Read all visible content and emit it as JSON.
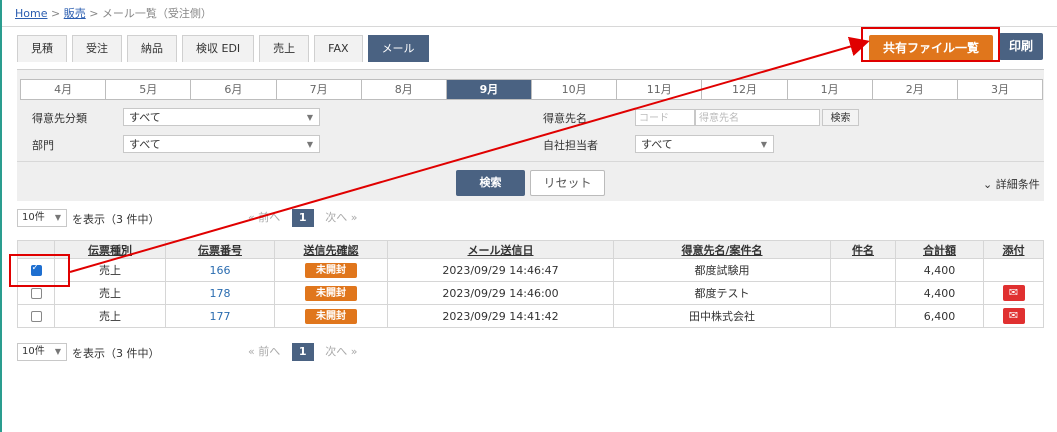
{
  "breadcrumb": {
    "home": "Home",
    "sales": "販売",
    "sep": ">",
    "current": "メール一覧（受注側）"
  },
  "tabs": [
    {
      "label": "見積"
    },
    {
      "label": "受注"
    },
    {
      "label": "納品"
    },
    {
      "label": "検収 EDI"
    },
    {
      "label": "売上"
    },
    {
      "label": "FAX"
    },
    {
      "label": "メール"
    }
  ],
  "active_tab": "メール",
  "actions": {
    "share_files": "共有ファイル一覧",
    "print": "印刷"
  },
  "months": [
    "4月",
    "5月",
    "6月",
    "7月",
    "8月",
    "9月",
    "10月",
    "11月",
    "12月",
    "1月",
    "2月",
    "3月"
  ],
  "active_month": "9月",
  "filters": {
    "customer_class_label": "得意先分類",
    "customer_class_value": "すべて",
    "dept_label": "部門",
    "dept_value": "すべて",
    "customer_name_label": "得意先名",
    "code_placeholder": "コード",
    "name_placeholder": "得意先名",
    "search_small": "検索",
    "staff_label": "自社担当者",
    "staff_value": "すべて"
  },
  "buttons": {
    "search": "検索",
    "reset": "リセット",
    "detail": "詳細条件"
  },
  "pagination": {
    "per_page": "10件",
    "display_text": "を表示（3 件中）",
    "prev": "前へ",
    "next": "次へ",
    "current_page": "1"
  },
  "table": {
    "headers": [
      "伝票種別",
      "伝票番号",
      "送信先確認",
      "メール送信日",
      "得意先名/案件名",
      "件名",
      "合計額",
      "添付"
    ],
    "rows": [
      {
        "checked": true,
        "type": "売上",
        "number": "166",
        "status": "未開封",
        "date": "2023/09/29 14:46:47",
        "customer": "都度試験用",
        "subject": "",
        "total": "4,400",
        "attach": false
      },
      {
        "checked": false,
        "type": "売上",
        "number": "178",
        "status": "未開封",
        "date": "2023/09/29 14:46:00",
        "customer": "都度テスト",
        "subject": "",
        "total": "4,400",
        "attach": true
      },
      {
        "checked": false,
        "type": "売上",
        "number": "177",
        "status": "未開封",
        "date": "2023/09/29 14:41:42",
        "customer": "田中株式会社",
        "subject": "",
        "total": "6,400",
        "attach": true
      }
    ]
  },
  "colors": {
    "accent": "#4a6282",
    "orange": "#e0761c",
    "highlight": "#e00000"
  },
  "icons": {
    "mail": "mail-icon",
    "dropdown": "chevron-down-icon",
    "detail": "chevron-down-icon"
  }
}
